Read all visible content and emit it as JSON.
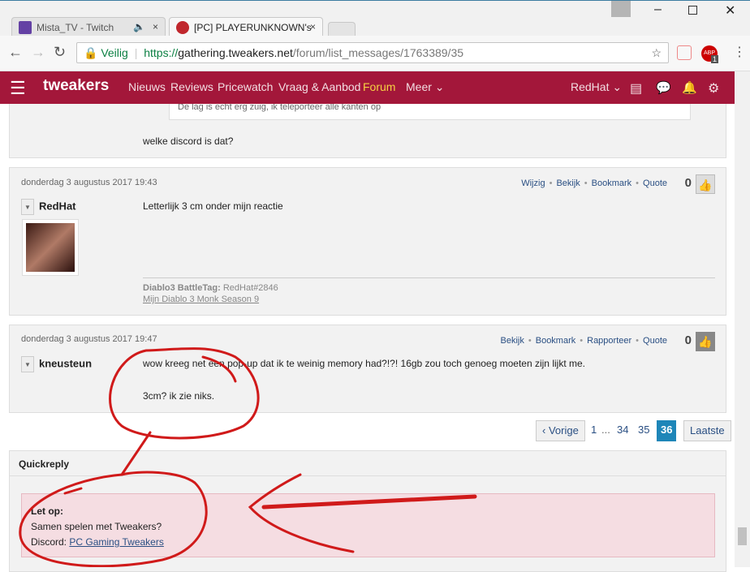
{
  "browser": {
    "tabs": [
      {
        "title": "Mista_TV - Twitch",
        "audio": "speaker-icon"
      },
      {
        "title": "[PC] PLAYERUNKNOWN's"
      }
    ],
    "secure_label": "Veilig",
    "url_scheme": "https://",
    "url_host": "gathering.tweakers.net",
    "url_path": "/forum/list_messages/1763389/35",
    "abp_badge": "1"
  },
  "nav": {
    "logo": "tweakers",
    "items": [
      "Nieuws",
      "Reviews",
      "Pricewatch",
      "Vraag & Aanbod",
      "Forum",
      "Meer"
    ],
    "user": "RedHat",
    "accent": "#a3173a",
    "active_color": "#f5d142"
  },
  "posts": [
    {
      "quote": "De lag is echt erg zuig, ik teleporteer alle kanten op",
      "text": "welke discord is dat?"
    },
    {
      "date": "donderdag 3 augustus 2017 19:43",
      "actions": [
        "Wijzig",
        "Bekijk",
        "Bookmark",
        "Quote"
      ],
      "score": "0",
      "user": "RedHat",
      "text": "Letterlijk 3 cm onder mijn reactie",
      "sig_label": "Diablo3 BattleTag:",
      "sig_value": "RedHat#2846",
      "sig_link": "Mijn Diablo 3 Monk Season 9"
    },
    {
      "date": "donderdag 3 augustus 2017 19:47",
      "actions": [
        "Bekijk",
        "Bookmark",
        "Rapporteer",
        "Quote"
      ],
      "score": "0",
      "user": "kneusteun",
      "text": "wow kreeg net een pop-up dat ik te weinig memory had?!?! 16gb zou toch genoeg moeten zijn lijkt me.",
      "text2": "3cm? ik zie niks."
    }
  ],
  "pagination": {
    "prev": "Vorige",
    "pages": [
      "1",
      "...",
      "34",
      "35",
      "36"
    ],
    "current": "36",
    "last": "Laatste"
  },
  "quickreply": {
    "title": "Quickreply",
    "notice_title": "Let op:",
    "notice_line1": "Samen spelen met Tweakers?",
    "notice_line2": "Discord:",
    "notice_link": "PC Gaming Tweakers"
  }
}
